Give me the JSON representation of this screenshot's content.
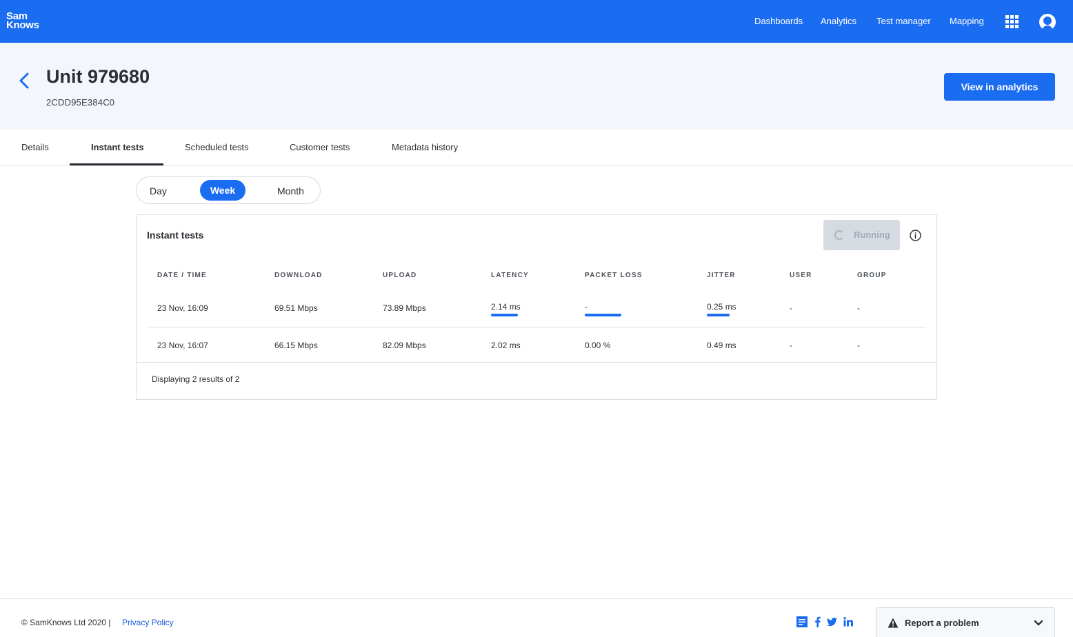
{
  "brand": {
    "line1": "Sam",
    "line2": "Knows"
  },
  "nav": {
    "links": [
      "Dashboards",
      "Analytics",
      "Test manager",
      "Mapping"
    ],
    "apps_icon": "grid-apps-icon",
    "account_icon": "user-avatar-icon"
  },
  "header": {
    "title": "Unit 979680",
    "subtitle": "2CDD95E384C0",
    "back_icon": "chevron-left-icon",
    "action_label": "View in analytics"
  },
  "tabs": {
    "items": [
      "Details",
      "Instant tests",
      "Scheduled tests",
      "Customer tests",
      "Metadata history"
    ],
    "active": "Instant tests"
  },
  "period": {
    "options": [
      "Day",
      "Week",
      "Month"
    ],
    "selected": "Week"
  },
  "card": {
    "title": "Instant tests",
    "running_label": "Running",
    "info_icon": "info-circle-icon",
    "columns": [
      "DATE / TIME",
      "DOWNLOAD",
      "UPLOAD",
      "LATENCY",
      "PACKET LOSS",
      "JITTER",
      "USER",
      "GROUP"
    ],
    "rows": [
      [
        "23 Nov, 16:09",
        "69.51 Mbps",
        "73.89 Mbps",
        "2.14 ms",
        "-",
        "0.25 ms",
        "-",
        "-"
      ],
      [
        "23 Nov, 16:07",
        "66.15 Mbps",
        "82.09 Mbps",
        "2.02 ms",
        "0.00 %",
        "0.49 ms",
        "-",
        "-"
      ]
    ],
    "footer": "Displaying 2 results of 2"
  },
  "footer": {
    "copyright": "© SamKnows Ltd 2020  |",
    "privacy": "Privacy Policy",
    "social_icons": [
      "blog-icon",
      "facebook-icon",
      "twitter-icon",
      "linkedin-icon"
    ],
    "report_label": "Report a problem",
    "accent": "#1a6cf0"
  }
}
